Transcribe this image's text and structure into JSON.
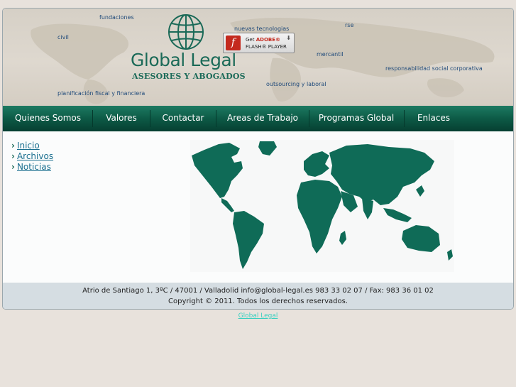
{
  "banner": {
    "logo_title": "Global Legal",
    "logo_subtitle": "ASESORES Y ABOGADOS",
    "tags": {
      "fundaciones": "fundaciones",
      "civil": "civil",
      "nuevas_tecnologias": "nuevas tecnologias",
      "rse": "rse",
      "mercantil": "mercantil",
      "responsabilidad": "responsabilidad social corporativa",
      "outsourcing": "outsourcing y laboral",
      "planificacion": "planificación fiscal y financiera"
    },
    "flash": {
      "get": "Get",
      "adobe": "ADOBE®",
      "player": "FLASH® PLAYER",
      "icon_letter": "f"
    }
  },
  "nav": {
    "items": [
      "Quienes Somos",
      "Valores",
      "Contactar",
      "Areas de Trabajo",
      "Programas Global",
      "Enlaces"
    ]
  },
  "sidebar": {
    "links": [
      "Inicio",
      "Archivos",
      "Noticias"
    ]
  },
  "footer": {
    "address": "Atrio de Santiago 1, 3ºC / 47001 / Valladolid info@global-legal.es 983 33 02 07 / Fax: 983 36 01 02",
    "copyright": "Copyright © 2011. Todos los derechos reservados."
  },
  "bottom_link": "Global Legal",
  "colors": {
    "brand_green": "#1b6a58",
    "nav_dark": "#063f31",
    "map_green": "#0f6b57",
    "footer_bg": "#d5dde2"
  }
}
